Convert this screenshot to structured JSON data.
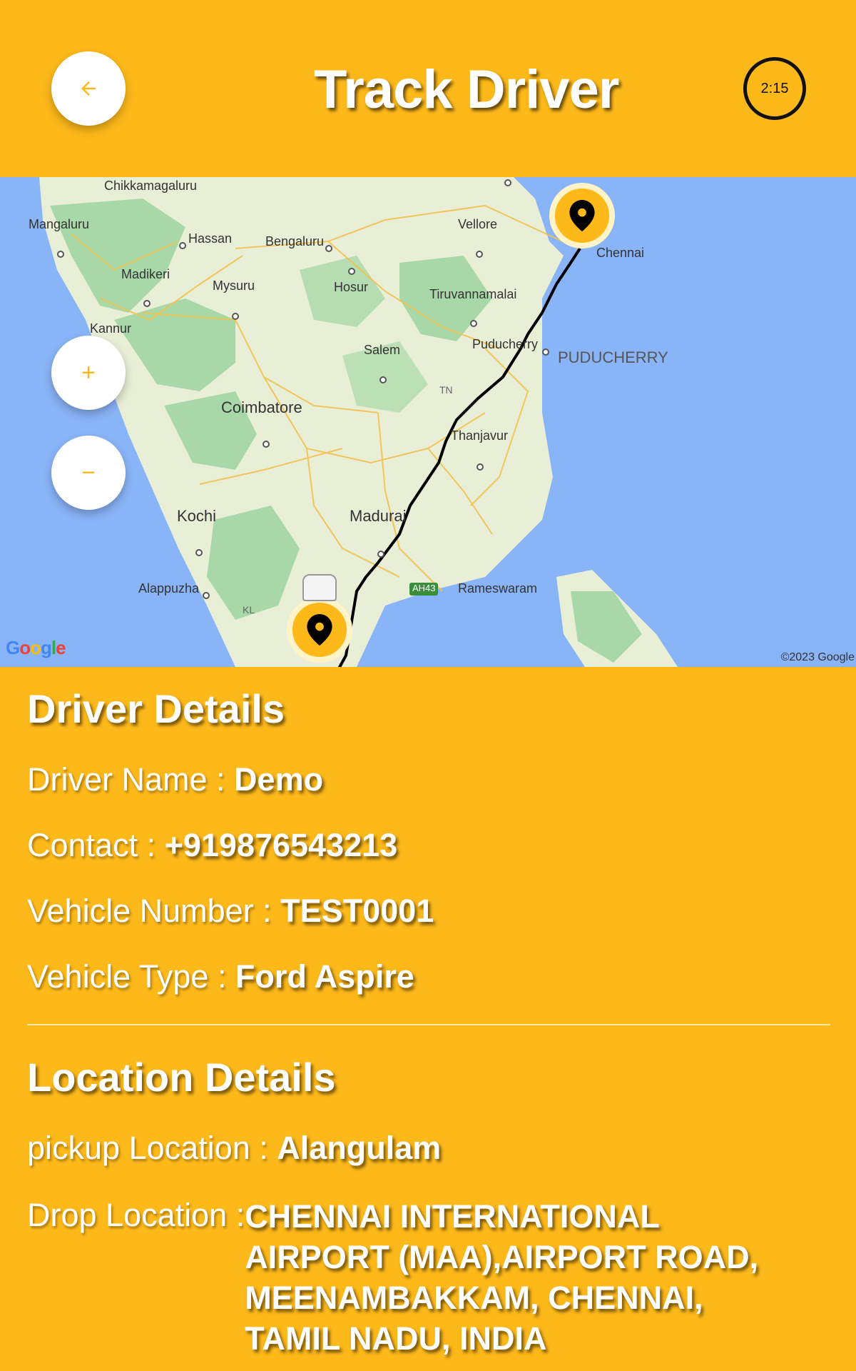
{
  "header": {
    "title": "Track Driver",
    "timer": "2:15",
    "back_icon": "arrow-left-icon"
  },
  "map": {
    "zoom_in_label": "+",
    "zoom_out_label": "−",
    "google_logo": "Google",
    "copyright": "©2023 Google",
    "places": [
      "Chikkamagaluru",
      "Mangaluru",
      "Hassan",
      "Bengaluru",
      "Vellore",
      "Chennai",
      "Madikeri",
      "Mysuru",
      "Hosur",
      "Tiruvannamalai",
      "Kannur",
      "Salem",
      "Puducherry",
      "PUDUCHERRY",
      "TN",
      "Coimbatore",
      "Thanjavur",
      "Kochi",
      "Madurai",
      "Alappuzha",
      "KL",
      "AH43",
      "Rameswaram"
    ],
    "colors": {
      "water": "#8AB4F8",
      "land": "#E9EFD6",
      "forest": "#A8D8A8",
      "route": "#000000"
    }
  },
  "driver": {
    "title": "Driver Details",
    "name_label": "Driver Name : ",
    "name": "Demo",
    "contact_label": "Contact : ",
    "contact": "+919876543213",
    "vehicle_number_label": "Vehicle Number : ",
    "vehicle_number": "TEST0001",
    "vehicle_type_label": "Vehicle Type : ",
    "vehicle_type": "Ford Aspire"
  },
  "location": {
    "title": "Location Details",
    "pickup_label": "pickup Location : ",
    "pickup": "Alangulam",
    "drop_label": "Drop Location : ",
    "drop": "CHENNAI INTERNATIONAL AIRPORT (MAA),AIRPORT ROAD, MEENAMBAKKAM, CHENNAI, TAMIL NADU, INDIA"
  },
  "theme": {
    "accent": "#FDB81A"
  }
}
